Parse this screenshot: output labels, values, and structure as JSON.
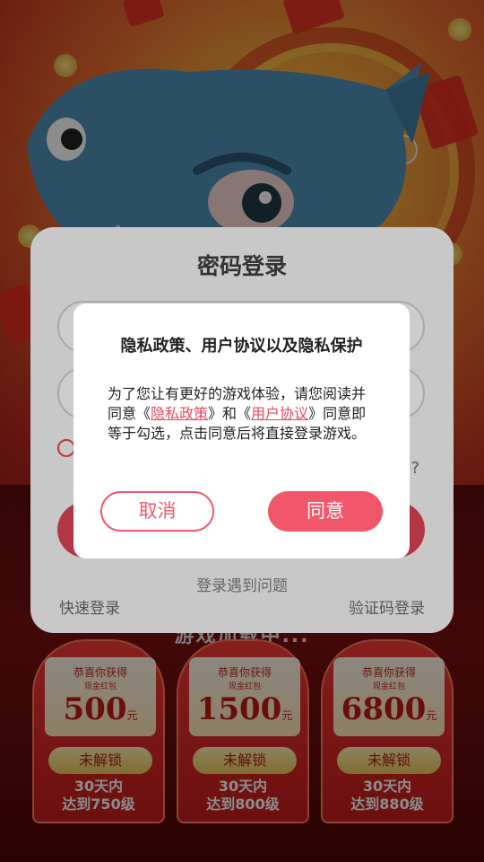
{
  "login": {
    "title": "密码登录",
    "problem_link": "登录遇到问题",
    "quick_login": "快速登录",
    "code_login": "验证码登录",
    "help_mark": "?"
  },
  "privacy_dialog": {
    "title": "隐私政策、用户协议以及隐私保护",
    "body_prefix": "为了您让有更好的游戏体验，请您阅读并同意《",
    "privacy_link": "隐私政策",
    "body_mid": "》和《",
    "agreement_link": "用户协议",
    "body_suffix": "》同意即等于勾选，点击同意后将直接登录游戏。",
    "cancel_label": "取消",
    "agree_label": "同意"
  },
  "background": {
    "loading_text": "游戏加载中...",
    "cards": [
      {
        "title": "恭喜你获得",
        "sub": "现金红包",
        "amount": "500",
        "unit": "元",
        "status": "未解锁",
        "req_line1": "30天内",
        "req_line2": "达到750级"
      },
      {
        "title": "恭喜你获得",
        "sub": "现金红包",
        "amount": "1500",
        "unit": "元",
        "status": "未解锁",
        "req_line1": "30天内",
        "req_line2": "达到800级"
      },
      {
        "title": "恭喜你获得",
        "sub": "现金红包",
        "amount": "6800",
        "unit": "元",
        "status": "未解锁",
        "req_line1": "30天内",
        "req_line2": "达到880级"
      }
    ]
  },
  "colors": {
    "accent": "#f2566a",
    "link": "#e8495d",
    "overlay": "rgba(0,0,0,0.45)"
  }
}
